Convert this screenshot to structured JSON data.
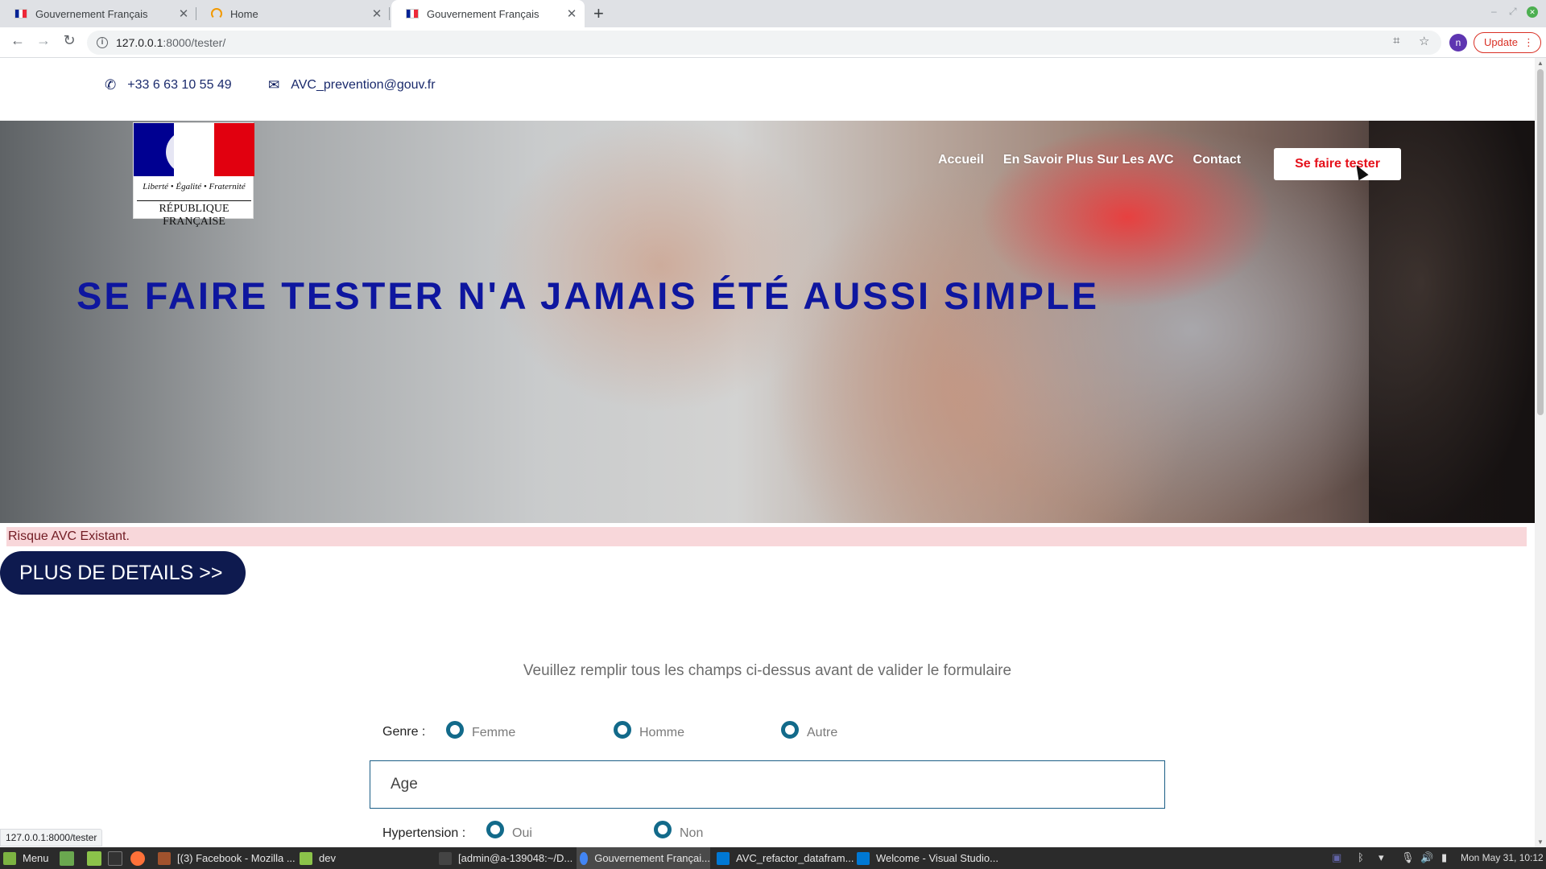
{
  "browser": {
    "tabs": [
      {
        "title": "Gouvernement Français",
        "active": false,
        "favicon": "french-flag-icon"
      },
      {
        "title": "Home",
        "active": false,
        "favicon": "loading-icon"
      },
      {
        "title": "Gouvernement Français",
        "active": true,
        "favicon": "french-flag-icon"
      }
    ],
    "address": {
      "host": "127.0.0.1",
      "path": ":8000/tester/"
    },
    "profile_initial": "n",
    "update_label": "Update"
  },
  "contact": {
    "phone": "+33 6 63 10 55 49",
    "email": "AVC_prevention@gouv.fr"
  },
  "logo": {
    "motto": "Liberté • Égalité • Fraternité",
    "name": "RÉPUBLIQUE FRANÇAISE"
  },
  "nav": {
    "links": [
      "Accueil",
      "En Savoir Plus Sur Les AVC",
      "Contact"
    ],
    "cta": "Se faire tester"
  },
  "hero": {
    "title": "SE FAIRE TESTER N'A JAMAIS ÉTÉ AUSSI SIMPLE"
  },
  "alert": {
    "text": "Risque AVC Existant."
  },
  "details_button": "PLUS DE DETAILS >>",
  "form": {
    "instruction": "Veuillez remplir tous les champs ci-dessus avant de valider le formulaire",
    "genre_label": "Genre :",
    "genre_options": [
      "Femme",
      "Homme",
      "Autre"
    ],
    "age_placeholder": "Age",
    "hypertension_label": "Hypertension :",
    "hypertension_options": [
      "Oui",
      "Non"
    ]
  },
  "status_url": "127.0.0.1:8000/tester",
  "taskbar": {
    "menu": "Menu",
    "items": [
      "[(3) Facebook - Mozilla ...",
      "dev",
      "[admin@a-139048:~/D...",
      "Gouvernement Françai...",
      "AVC_refactor_datafram...",
      "Welcome - Visual Studio..."
    ],
    "clock": "Mon May 31, 10:12"
  },
  "colors": {
    "hero_title": "#0e169f",
    "cta_text": "#e5101a",
    "details_button_bg": "#0e1a4f",
    "alert_bg": "#f8d7da",
    "radio_ring": "#126a8a"
  }
}
